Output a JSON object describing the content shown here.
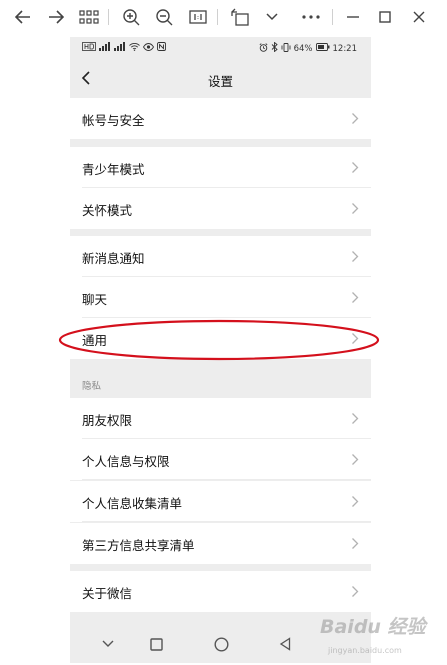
{
  "status_bar": {
    "battery": "64%",
    "time": "12:21"
  },
  "header": {
    "title": "设置"
  },
  "settings_items": {
    "account_security": "帐号与安全",
    "teen_mode": "青少年模式",
    "care_mode": "关怀模式",
    "new_message_notifications": "新消息通知",
    "chat": "聊天",
    "general": "通用",
    "privacy_section": "隐私",
    "friend_permissions": "朋友权限",
    "personal_info_permissions": "个人信息与权限",
    "personal_info_collection": "个人信息收集清单",
    "third_party_sharing": "第三方信息共享清单",
    "about_wechat": "关于微信"
  },
  "watermark": {
    "logo_text": "Baidu 经验",
    "sub_text": "jingyan.baidu.com"
  },
  "colors": {
    "background": "#ededed",
    "row": "#ffffff",
    "highlight": "#d4101c"
  }
}
